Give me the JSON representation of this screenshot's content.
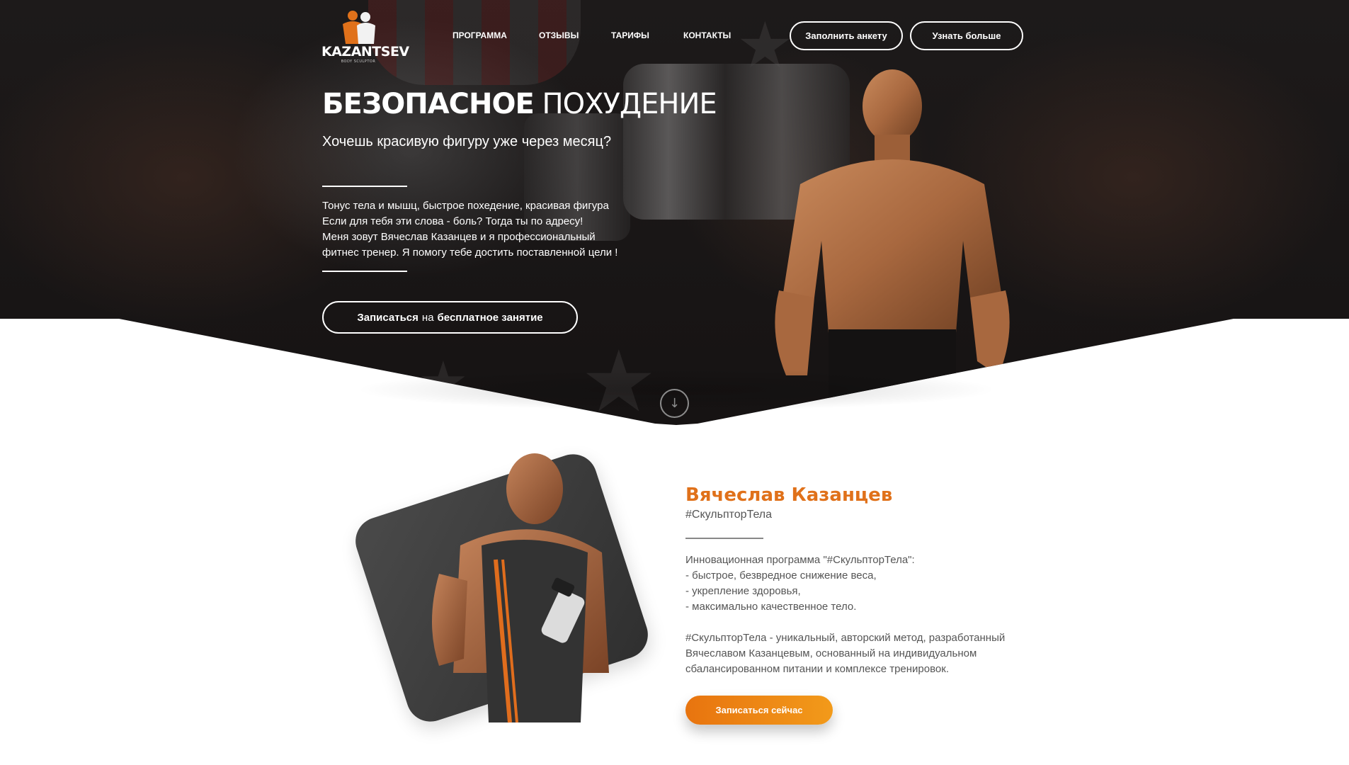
{
  "header": {
    "logo_text": "KAZANTSEV",
    "logo_sub": "BODY SCULPTOR",
    "nav": [
      {
        "label": "ПРОГРАММА"
      },
      {
        "label": "ОТЗЫВЫ"
      },
      {
        "label": "ТАРИФЫ"
      },
      {
        "label": "КОНТАКТЫ"
      }
    ],
    "btn_form": "Заполнить анкету",
    "btn_more": "Узнать больше"
  },
  "hero": {
    "title_bold": "БЕЗОПАСНОЕ",
    "title_light": "ПОХУДЕНИЕ",
    "subtitle": "Хочешь красивую фигуру уже через месяц?",
    "desc_lines": [
      "Тонус тела и мышц, быстрое похедение, красивая фигура",
      "Если для тебя эти слова - боль? Тогда ты по адресу!",
      "Меня зовут Вячеслав Казанцев и я профессиональный",
      "фитнес тренер. Я помогу тебе достить поставленной цели !"
    ],
    "cta": {
      "part1": "Записаться",
      "part2": "на",
      "part3": "бесплатное занятие"
    },
    "scroll_icon": "↓"
  },
  "about": {
    "name": "Вячеслав Казанцев",
    "tag": "#СкульпторТела",
    "desc_lines": [
      "Инновационная программа \"#СкульпторТела\":",
      "- быстрое, безвредное снижение веса,",
      "- укрепление здоровья,",
      "- максимально качественное тело.",
      "",
      "#СкульпторТела - уникальный, авторский метод, разработанный",
      "Вячеславом Казанцевым, основанный на индивидуальном",
      "сбалансированном питании и комплексе тренировок."
    ],
    "cta": "Записаться сейчас"
  },
  "colors": {
    "accent": "#e0711a",
    "hero_bg": "#1a1717"
  }
}
